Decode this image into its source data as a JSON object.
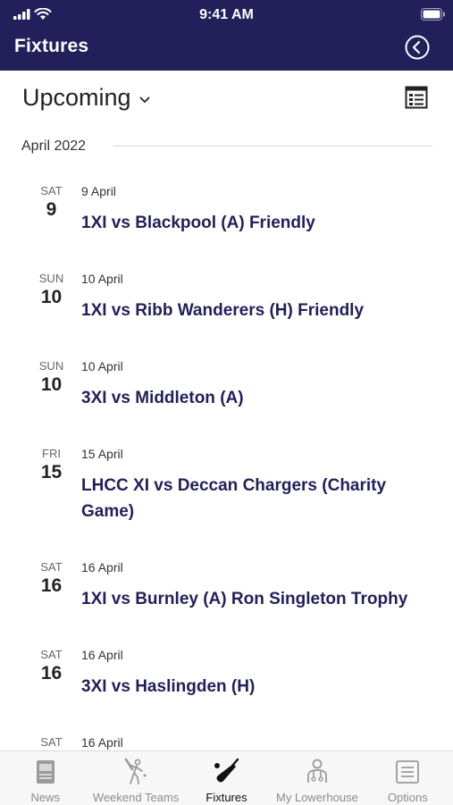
{
  "status_bar": {
    "time": "9:41 AM"
  },
  "header": {
    "title": "Fixtures",
    "back_icon": "chevron-left-circle-icon",
    "bg_color": "#221f5b"
  },
  "filter": {
    "label": "Upcoming"
  },
  "month_label": "April 2022",
  "fixtures": [
    {
      "dow": "SAT",
      "day": "9",
      "date": "9 April",
      "title": "1XI vs Blackpool (A) Friendly"
    },
    {
      "dow": "SUN",
      "day": "10",
      "date": "10 April",
      "title": "1XI vs Ribb Wanderers (H) Friendly"
    },
    {
      "dow": "SUN",
      "day": "10",
      "date": "10 April",
      "title": "3XI vs Middleton (A)"
    },
    {
      "dow": "FRI",
      "day": "15",
      "date": "15 April",
      "title": "LHCC XI vs Deccan Chargers (Charity Game)"
    },
    {
      "dow": "SAT",
      "day": "16",
      "date": "16 April",
      "title": "1XI vs Burnley (A) Ron Singleton Trophy"
    },
    {
      "dow": "SAT",
      "day": "16",
      "date": "16 April",
      "title": "3XI vs Haslingden (H)"
    },
    {
      "dow": "SAT",
      "day": "",
      "date": "16 April",
      "title": ""
    }
  ],
  "tabs": [
    {
      "label": "News",
      "icon": "newspaper-icon"
    },
    {
      "label": "Weekend Teams",
      "icon": "batsman-icon"
    },
    {
      "label": "Fixtures",
      "icon": "cricket-bat-icon",
      "active": true
    },
    {
      "label": "My Lowerhouse",
      "icon": "person-icon"
    },
    {
      "label": "Options",
      "icon": "list-icon"
    }
  ]
}
